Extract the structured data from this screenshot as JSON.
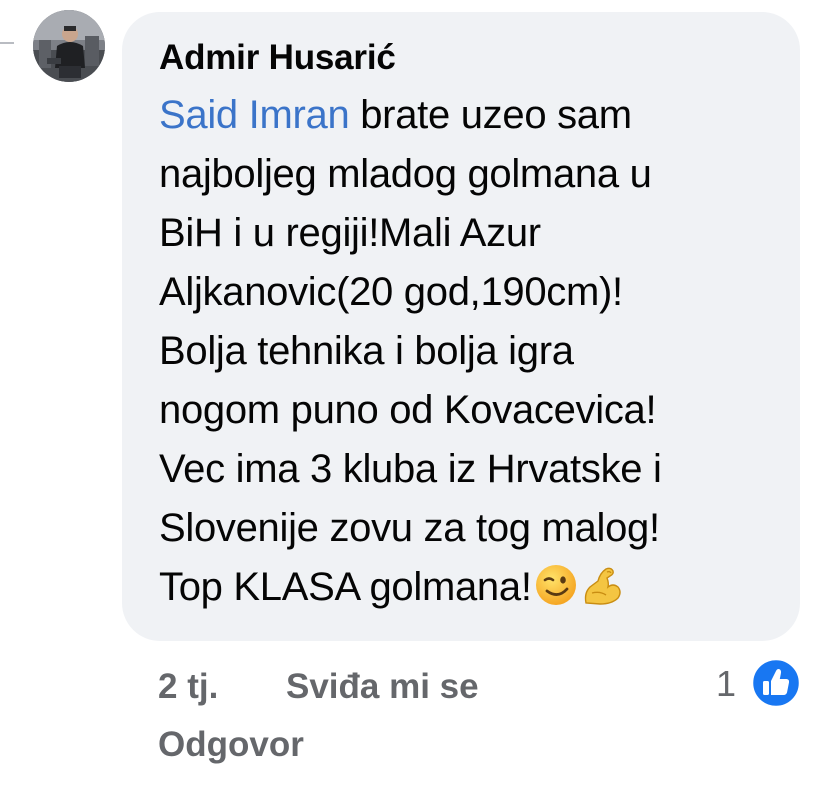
{
  "comment": {
    "author": "Admir Husarić",
    "mention": "Said Imran",
    "first_line_rest": " brate uzeo sam",
    "lines": [
      "najboljeg mladog golmana u",
      "BiH i u regiji!Mali Azur",
      "Aljkanovic(20 god,190cm)!",
      "Bolja tehnika i bolja igra",
      "nogom puno od Kovacevica!",
      "Vec ima 3 kluba iz Hrvatske i",
      "Slovenije zovu za tog malog!"
    ],
    "last_line": "Top KLASA golmana!",
    "emojis": [
      "winking-face-emoji",
      "flexed-biceps-emoji"
    ]
  },
  "footer": {
    "time": "2 tj.",
    "like_label": "Sviđa mi se",
    "reply_label": "Odgovor",
    "reaction_count": "1",
    "reaction_icon": "thumbs-up-icon"
  },
  "colors": {
    "bubble": "#f0f2f5",
    "mention": "#3b74c9",
    "meta": "#65676b",
    "like_blue": "#1877f2"
  }
}
